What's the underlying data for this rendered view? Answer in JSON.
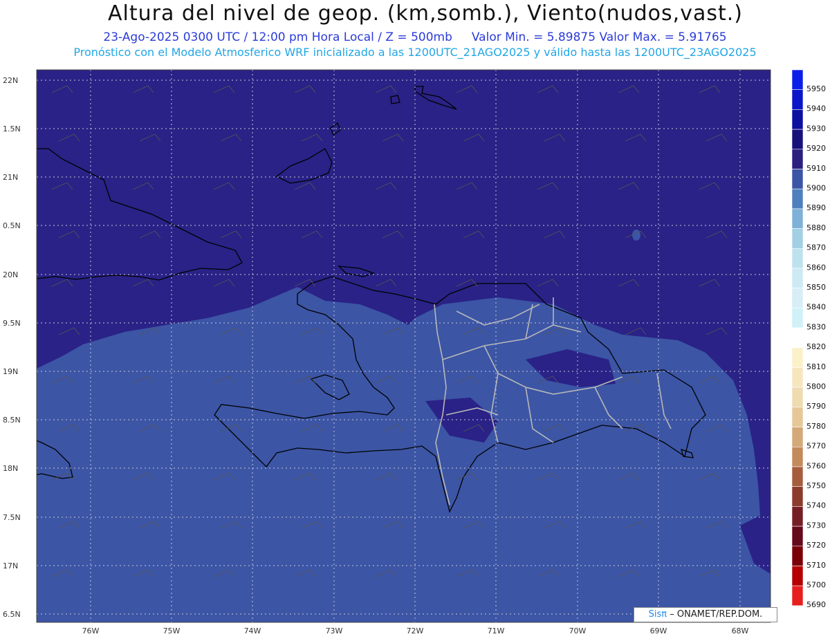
{
  "header": {
    "title": "Altura del nivel de geop. (km,somb.), Viento(nudos,vast.)",
    "date_line": "23-Ago-2025  0300 UTC / 12:00 pm Hora Local / Z = 500mb",
    "min_max": "Valor Min. = 5.89875  Valor Max. = 5.91765",
    "model_line": "Pronóstico con el Modelo Atmosferico WRF inicializado a las 1200UTC_21AGO2025 y válido hasta las  1200UTC_23AGO2025"
  },
  "axes": {
    "lat_labels": [
      "22N",
      "1.5N",
      "21N",
      "0.5N",
      "20N",
      "9.5N",
      "19N",
      "8.5N",
      "18N",
      "7.5N",
      "17N",
      "6.5N"
    ],
    "lon_labels": [
      "76W",
      "75W",
      "74W",
      "73W",
      "72W",
      "71W",
      "70W",
      "69W",
      "68W"
    ]
  },
  "colorbar": {
    "levels": [
      "5950",
      "5940",
      "5930",
      "5920",
      "5910",
      "5900",
      "5890",
      "5880",
      "5870",
      "5860",
      "5850",
      "5840",
      "5830",
      "5820",
      "5810",
      "5800",
      "5790",
      "5780",
      "5770",
      "5760",
      "5750",
      "5740",
      "5730",
      "5720",
      "5710",
      "5700",
      "5690"
    ],
    "colors": [
      "#0b1ee8",
      "#0a16c8",
      "#0c0fa0",
      "#17127a",
      "#2b2080",
      "#3c55a6",
      "#4f7fbe",
      "#7fb1d8",
      "#a3cfe5",
      "#bde2ee",
      "#cdeaf4",
      "#d7eef6",
      "#cff1f7",
      "#ffffff",
      "#fbf1c8",
      "#f5e6be",
      "#efdbb0",
      "#e5c798",
      "#d4a978",
      "#c38a5a",
      "#a65d3e",
      "#8c3b2c",
      "#751f24",
      "#650a1a",
      "#7a0008",
      "#b40000",
      "#e61e1e"
    ]
  },
  "fields": {
    "north_color": "#2a2286",
    "south_color": "#3c55a5",
    "land_outline": "#000000",
    "border_color": "#b8b8b8"
  },
  "footer": {
    "brand": "Sisπ",
    "credit": "– ONAMET/REP.DOM."
  }
}
